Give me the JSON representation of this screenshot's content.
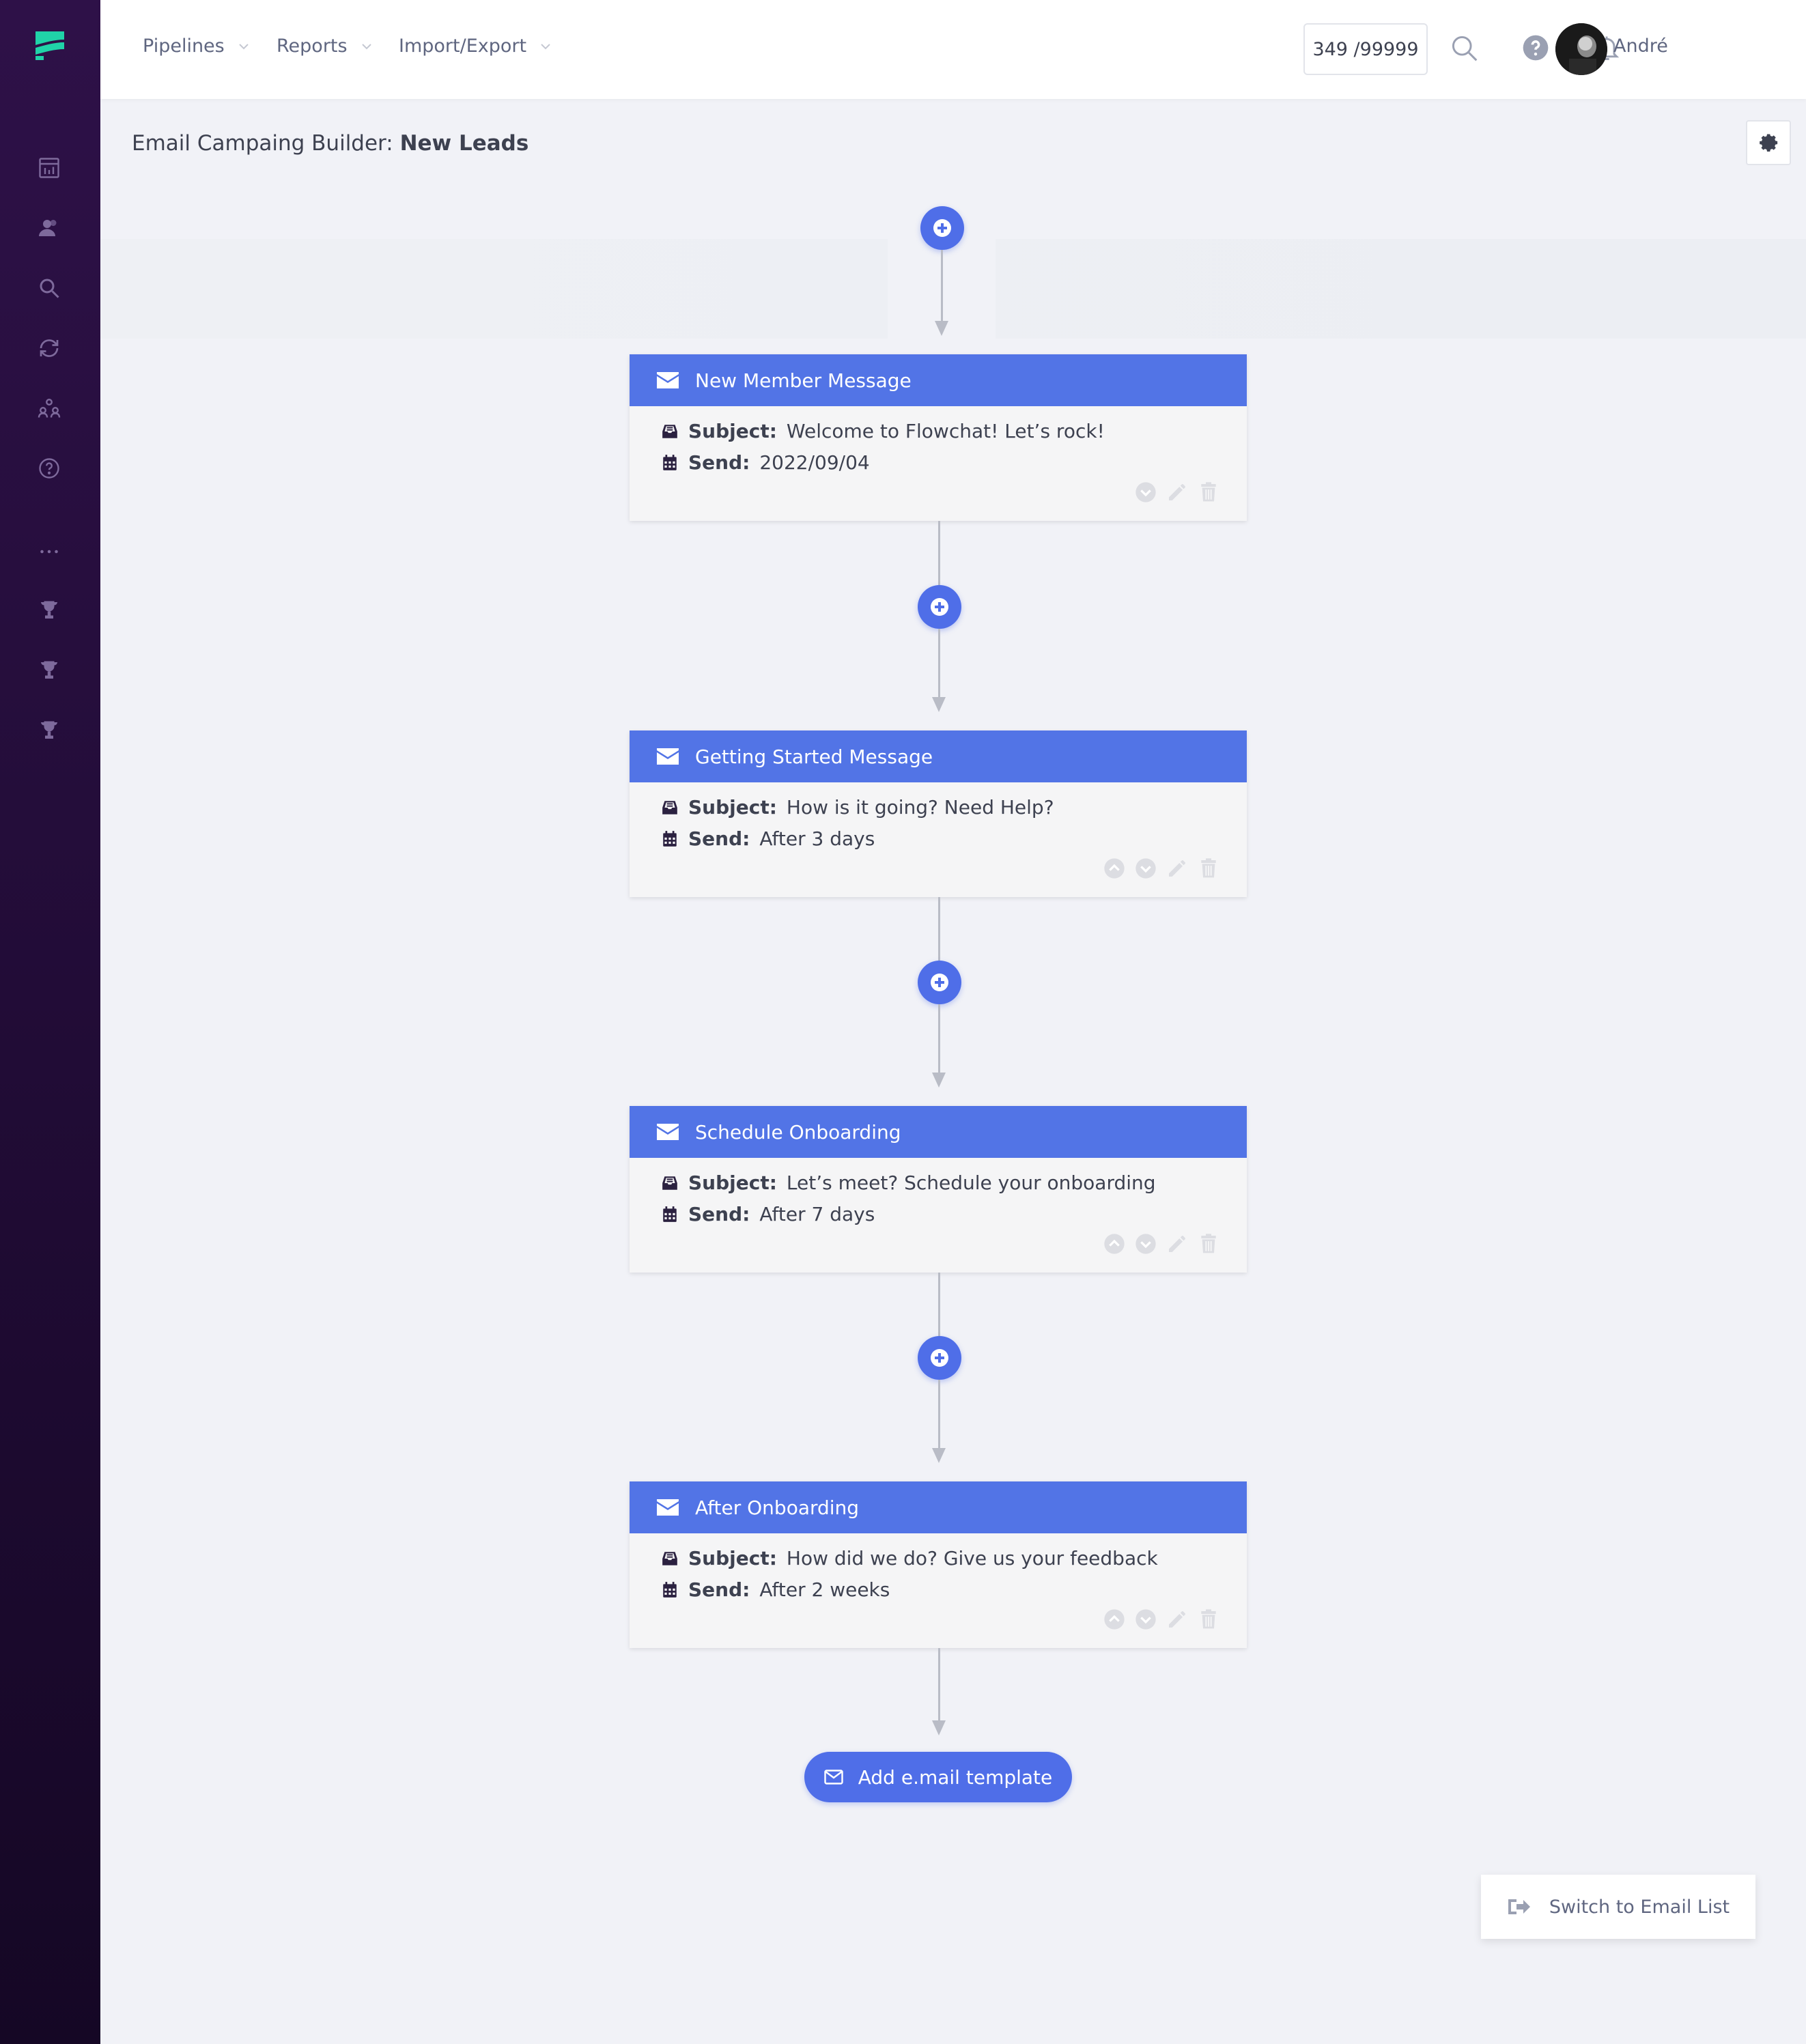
{
  "colors": {
    "accent": "#4f6ee8",
    "card_header": "#5274e6",
    "sidebar": "#2e1148",
    "brand": "#20d3a8"
  },
  "nav": {
    "items": [
      {
        "label": "Pipelines",
        "icon": "chevron-down-icon"
      },
      {
        "label": "Reports",
        "icon": "chevron-down-icon"
      },
      {
        "label": "Import/Export",
        "icon": "chevron-down-icon"
      }
    ],
    "counter": "349 /99999",
    "user_name": "André"
  },
  "sidebar": {
    "icons": [
      "dashboard-icon",
      "contacts-icon",
      "search-icon",
      "sync-icon",
      "team-icon",
      "help-icon",
      "more-icon",
      "trophy-icon",
      "trophy-icon",
      "trophy-icon"
    ]
  },
  "page": {
    "title_prefix": "Email Campaing Builder: ",
    "title_bold": "New Leads"
  },
  "cards": [
    {
      "title": "New Member Message",
      "subject_label": "Subject:",
      "subject": "Welcome to Flowchat! Let’s rock!",
      "send_label": "Send:",
      "send": "2022/09/04"
    },
    {
      "title": "Getting Started Message",
      "subject_label": "Subject:",
      "subject": "How is it going? Need Help?",
      "send_label": "Send:",
      "send": "After 3 days"
    },
    {
      "title": "Schedule Onboarding",
      "subject_label": "Subject:",
      "subject": "Let’s meet? Schedule your onboarding",
      "send_label": "Send:",
      "send": "After 7 days"
    },
    {
      "title": "After Onboarding",
      "subject_label": "Subject:",
      "subject": "How did we do? Give us your feedback",
      "send_label": "Send:",
      "send": "After 2 weeks"
    }
  ],
  "add_template_label": "Add e.mail template",
  "switch_label": "Switch to Email List"
}
